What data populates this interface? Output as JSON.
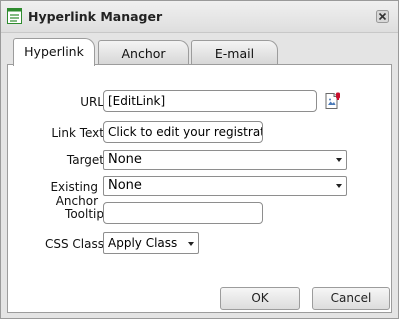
{
  "window": {
    "title": "Hyperlink Manager",
    "title_icon": "hyperlink-manager-icon",
    "close_icon": "close-icon"
  },
  "tabs": [
    {
      "label": "Hyperlink",
      "active": true
    },
    {
      "label": "Anchor",
      "active": false
    },
    {
      "label": "E-mail",
      "active": false
    }
  ],
  "form": {
    "url": {
      "label": "URL",
      "value": "[EditLink]",
      "browse_icon": "document-browse-icon"
    },
    "link_text": {
      "label": "Link Text",
      "value": "Click to edit your registration"
    },
    "target": {
      "label": "Target",
      "value": "None"
    },
    "existing_anchor": {
      "label": "Existing Anchor",
      "value": "None"
    },
    "tooltip": {
      "label": "Tooltip",
      "value": ""
    },
    "css_class": {
      "label": "CSS Class",
      "value": "Apply Class"
    }
  },
  "buttons": {
    "ok": "OK",
    "cancel": "Cancel"
  },
  "colors": {
    "dialog_bg": "#e4e4e4",
    "panel_bg": "#ffffff",
    "border": "#9c9c9c",
    "title_icon_green": "#2e8b2e"
  }
}
